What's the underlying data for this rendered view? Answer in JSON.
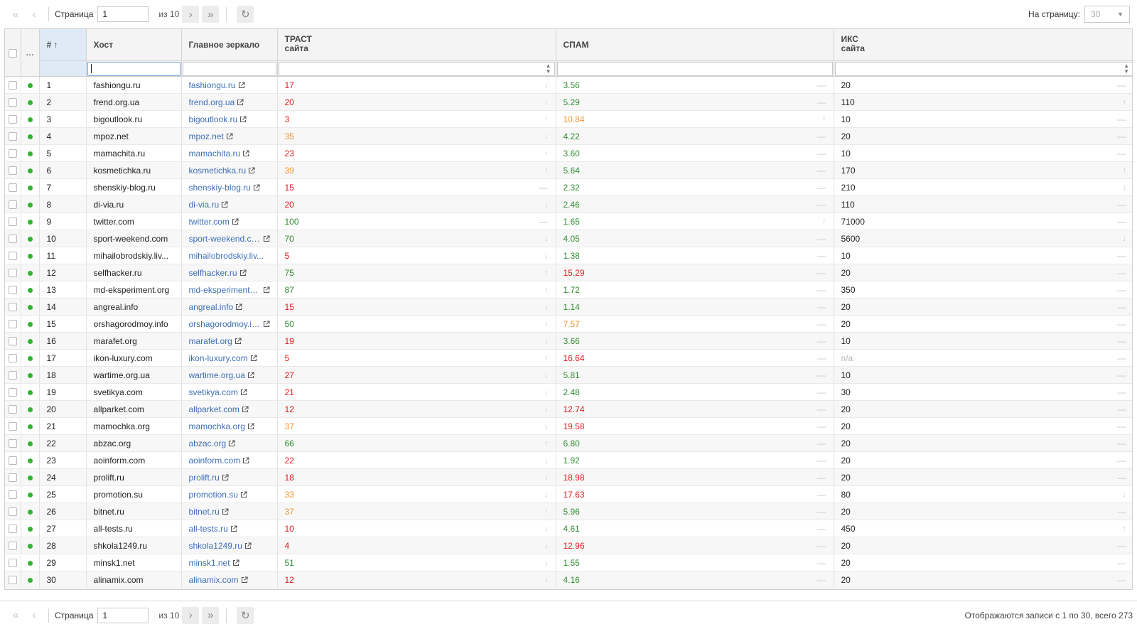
{
  "toolbar": {
    "first_icon": "«",
    "prev_icon": "‹",
    "next_icon": "›",
    "last_icon": "»",
    "refresh_icon": "↻",
    "page_label": "Страница",
    "page_value": "1",
    "of_label": "из 10",
    "per_page_label": "На страницу:",
    "per_page_value": "30",
    "status": "Отображаются записи с 1 по 30, всего 273"
  },
  "columns": {
    "more": "…",
    "num": "# ↑",
    "host": "Хост",
    "mirror": "Главное зеркало",
    "trust": "ТРАСТ",
    "trust_sub": "сайта",
    "spam": "СПАМ",
    "iks": "ИКС",
    "iks_sub": "сайта"
  },
  "filters": {
    "host_value": "",
    "spin_icon": "▲▼"
  },
  "icons": {
    "external_link": "external-link-icon",
    "status_dot": "status-dot-icon",
    "trend_up": "↑",
    "trend_down": "↓",
    "trend_flat": "—"
  },
  "colors": {
    "green": "#2e8b2e",
    "red": "#e2191b",
    "orange": "#f0952f",
    "link": "#3d6fb6",
    "status_dot": "#34b233"
  },
  "rows": [
    {
      "num": "1",
      "host": "fashiongu.ru",
      "mirror": "fashiongu.ru",
      "trust": "17",
      "trust_c": "red",
      "trust_t": "down",
      "spam": "3.56",
      "spam_c": "green",
      "spam_t": "flat",
      "iks": "20",
      "iks_c": "dark",
      "iks_t": "flat"
    },
    {
      "num": "2",
      "host": "frend.org.ua",
      "mirror": "frend.org.ua",
      "trust": "20",
      "trust_c": "red",
      "trust_t": "down",
      "spam": "5.29",
      "spam_c": "green",
      "spam_t": "flat",
      "iks": "110",
      "iks_c": "dark",
      "iks_t": "up"
    },
    {
      "num": "3",
      "host": "bigoutlook.ru",
      "mirror": "bigoutlook.ru",
      "trust": "3",
      "trust_c": "red",
      "trust_t": "up",
      "spam": "10.84",
      "spam_c": "orange",
      "spam_t": "up",
      "iks": "10",
      "iks_c": "dark",
      "iks_t": "flat"
    },
    {
      "num": "4",
      "host": "mpoz.net",
      "mirror": "mpoz.net",
      "trust": "35",
      "trust_c": "orange",
      "trust_t": "down",
      "spam": "4.22",
      "spam_c": "green",
      "spam_t": "flat",
      "iks": "20",
      "iks_c": "dark",
      "iks_t": "flat"
    },
    {
      "num": "5",
      "host": "mamachita.ru",
      "mirror": "mamachita.ru",
      "trust": "23",
      "trust_c": "red",
      "trust_t": "up",
      "spam": "3.60",
      "spam_c": "green",
      "spam_t": "flat",
      "iks": "10",
      "iks_c": "dark",
      "iks_t": "flat"
    },
    {
      "num": "6",
      "host": "kosmetichka.ru",
      "mirror": "kosmetichka.ru",
      "trust": "39",
      "trust_c": "orange",
      "trust_t": "up",
      "spam": "5.64",
      "spam_c": "green",
      "spam_t": "flat",
      "iks": "170",
      "iks_c": "dark",
      "iks_t": "up"
    },
    {
      "num": "7",
      "host": "shenskiy-blog.ru",
      "mirror": "shenskiy-blog.ru",
      "trust": "15",
      "trust_c": "red",
      "trust_t": "flat",
      "spam": "2.32",
      "spam_c": "green",
      "spam_t": "flat",
      "iks": "210",
      "iks_c": "dark",
      "iks_t": "down"
    },
    {
      "num": "8",
      "host": "di-via.ru",
      "mirror": "di-via.ru",
      "trust": "20",
      "trust_c": "red",
      "trust_t": "down",
      "spam": "2.46",
      "spam_c": "green",
      "spam_t": "flat",
      "iks": "110",
      "iks_c": "dark",
      "iks_t": "flat"
    },
    {
      "num": "9",
      "host": "twitter.com",
      "mirror": "twitter.com",
      "trust": "100",
      "trust_c": "green",
      "trust_t": "flat",
      "spam": "1.65",
      "spam_c": "green",
      "spam_t": "up",
      "iks": "71000",
      "iks_c": "dark",
      "iks_t": "flat"
    },
    {
      "num": "10",
      "host": "sport-weekend.com",
      "mirror": "sport-weekend.com",
      "trust": "70",
      "trust_c": "green",
      "trust_t": "down",
      "spam": "4.05",
      "spam_c": "green",
      "spam_t": "flat",
      "iks": "5600",
      "iks_c": "dark",
      "iks_t": "down"
    },
    {
      "num": "11",
      "host": "mihailobrodskiy.liv...",
      "mirror": "mihailobrodskiy.liv...",
      "mirror_noicon": true,
      "trust": "5",
      "trust_c": "red",
      "trust_t": "down",
      "spam": "1.38",
      "spam_c": "green",
      "spam_t": "flat",
      "iks": "10",
      "iks_c": "dark",
      "iks_t": "flat"
    },
    {
      "num": "12",
      "host": "selfhacker.ru",
      "mirror": "selfhacker.ru",
      "trust": "75",
      "trust_c": "green",
      "trust_t": "up",
      "spam": "15.29",
      "spam_c": "red",
      "spam_t": "flat",
      "iks": "20",
      "iks_c": "dark",
      "iks_t": "flat"
    },
    {
      "num": "13",
      "host": "md-eksperiment.org",
      "mirror": "md-eksperiment.o...",
      "trust": "87",
      "trust_c": "green",
      "trust_t": "up",
      "spam": "1.72",
      "spam_c": "green",
      "spam_t": "flat",
      "iks": "350",
      "iks_c": "dark",
      "iks_t": "flat"
    },
    {
      "num": "14",
      "host": "angreal.info",
      "mirror": "angreal.info",
      "trust": "15",
      "trust_c": "red",
      "trust_t": "down",
      "spam": "1.14",
      "spam_c": "green",
      "spam_t": "flat",
      "iks": "20",
      "iks_c": "dark",
      "iks_t": "flat"
    },
    {
      "num": "15",
      "host": "orshagorodmoy.info",
      "mirror": "orshagorodmoy.info",
      "trust": "50",
      "trust_c": "green",
      "trust_t": "down",
      "spam": "7.57",
      "spam_c": "orange",
      "spam_t": "flat",
      "iks": "20",
      "iks_c": "dark",
      "iks_t": "flat"
    },
    {
      "num": "16",
      "host": "marafet.org",
      "mirror": "marafet.org",
      "trust": "19",
      "trust_c": "red",
      "trust_t": "down",
      "spam": "3.66",
      "spam_c": "green",
      "spam_t": "flat",
      "iks": "10",
      "iks_c": "dark",
      "iks_t": "flat"
    },
    {
      "num": "17",
      "host": "ikon-luxury.com",
      "mirror": "ikon-luxury.com",
      "trust": "5",
      "trust_c": "red",
      "trust_t": "up",
      "spam": "16.64",
      "spam_c": "red",
      "spam_t": "flat",
      "iks": "n/a",
      "iks_c": "gray",
      "iks_t": "flat"
    },
    {
      "num": "18",
      "host": "wartime.org.ua",
      "mirror": "wartime.org.ua",
      "trust": "27",
      "trust_c": "red",
      "trust_t": "down",
      "spam": "5.81",
      "spam_c": "green",
      "spam_t": "flat",
      "iks": "10",
      "iks_c": "dark",
      "iks_t": "flat"
    },
    {
      "num": "19",
      "host": "svetikya.com",
      "mirror": "svetikya.com",
      "trust": "21",
      "trust_c": "red",
      "trust_t": "down",
      "spam": "2.48",
      "spam_c": "green",
      "spam_t": "flat",
      "iks": "30",
      "iks_c": "dark",
      "iks_t": "flat"
    },
    {
      "num": "20",
      "host": "allparket.com",
      "mirror": "allparket.com",
      "trust": "12",
      "trust_c": "red",
      "trust_t": "down",
      "spam": "12.74",
      "spam_c": "red",
      "spam_t": "flat",
      "iks": "20",
      "iks_c": "dark",
      "iks_t": "flat"
    },
    {
      "num": "21",
      "host": "mamochka.org",
      "mirror": "mamochka.org",
      "trust": "37",
      "trust_c": "orange",
      "trust_t": "down",
      "spam": "19.58",
      "spam_c": "red",
      "spam_t": "flat",
      "iks": "20",
      "iks_c": "dark",
      "iks_t": "flat"
    },
    {
      "num": "22",
      "host": "abzac.org",
      "mirror": "abzac.org",
      "trust": "66",
      "trust_c": "green",
      "trust_t": "up",
      "spam": "6.80",
      "spam_c": "green",
      "spam_t": "flat",
      "iks": "20",
      "iks_c": "dark",
      "iks_t": "flat"
    },
    {
      "num": "23",
      "host": "aoinform.com",
      "mirror": "aoinform.com",
      "trust": "22",
      "trust_c": "red",
      "trust_t": "down",
      "spam": "1.92",
      "spam_c": "green",
      "spam_t": "flat",
      "iks": "20",
      "iks_c": "dark",
      "iks_t": "flat"
    },
    {
      "num": "24",
      "host": "prolift.ru",
      "mirror": "prolift.ru",
      "trust": "18",
      "trust_c": "red",
      "trust_t": "down",
      "spam": "18.98",
      "spam_c": "red",
      "spam_t": "flat",
      "iks": "20",
      "iks_c": "dark",
      "iks_t": "flat"
    },
    {
      "num": "25",
      "host": "promotion.su",
      "mirror": "promotion.su",
      "trust": "33",
      "trust_c": "orange",
      "trust_t": "down",
      "spam": "17.63",
      "spam_c": "red",
      "spam_t": "flat",
      "iks": "80",
      "iks_c": "dark",
      "iks_t": "down"
    },
    {
      "num": "26",
      "host": "bitnet.ru",
      "mirror": "bitnet.ru",
      "trust": "37",
      "trust_c": "orange",
      "trust_t": "up",
      "spam": "5.96",
      "spam_c": "green",
      "spam_t": "flat",
      "iks": "20",
      "iks_c": "dark",
      "iks_t": "flat"
    },
    {
      "num": "27",
      "host": "all-tests.ru",
      "mirror": "all-tests.ru",
      "trust": "10",
      "trust_c": "red",
      "trust_t": "down",
      "spam": "4.61",
      "spam_c": "green",
      "spam_t": "flat",
      "iks": "450",
      "iks_c": "dark",
      "iks_t": "up"
    },
    {
      "num": "28",
      "host": "shkola1249.ru",
      "mirror": "shkola1249.ru",
      "trust": "4",
      "trust_c": "red",
      "trust_t": "down",
      "spam": "12.96",
      "spam_c": "red",
      "spam_t": "flat",
      "iks": "20",
      "iks_c": "dark",
      "iks_t": "flat"
    },
    {
      "num": "29",
      "host": "minsk1.net",
      "mirror": "minsk1.net",
      "trust": "51",
      "trust_c": "green",
      "trust_t": "down",
      "spam": "1.55",
      "spam_c": "green",
      "spam_t": "flat",
      "iks": "20",
      "iks_c": "dark",
      "iks_t": "flat"
    },
    {
      "num": "30",
      "host": "alinamix.com",
      "mirror": "alinamix.com",
      "trust": "12",
      "trust_c": "red",
      "trust_t": "down",
      "spam": "4.16",
      "spam_c": "green",
      "spam_t": "flat",
      "iks": "20",
      "iks_c": "dark",
      "iks_t": "flat"
    }
  ]
}
